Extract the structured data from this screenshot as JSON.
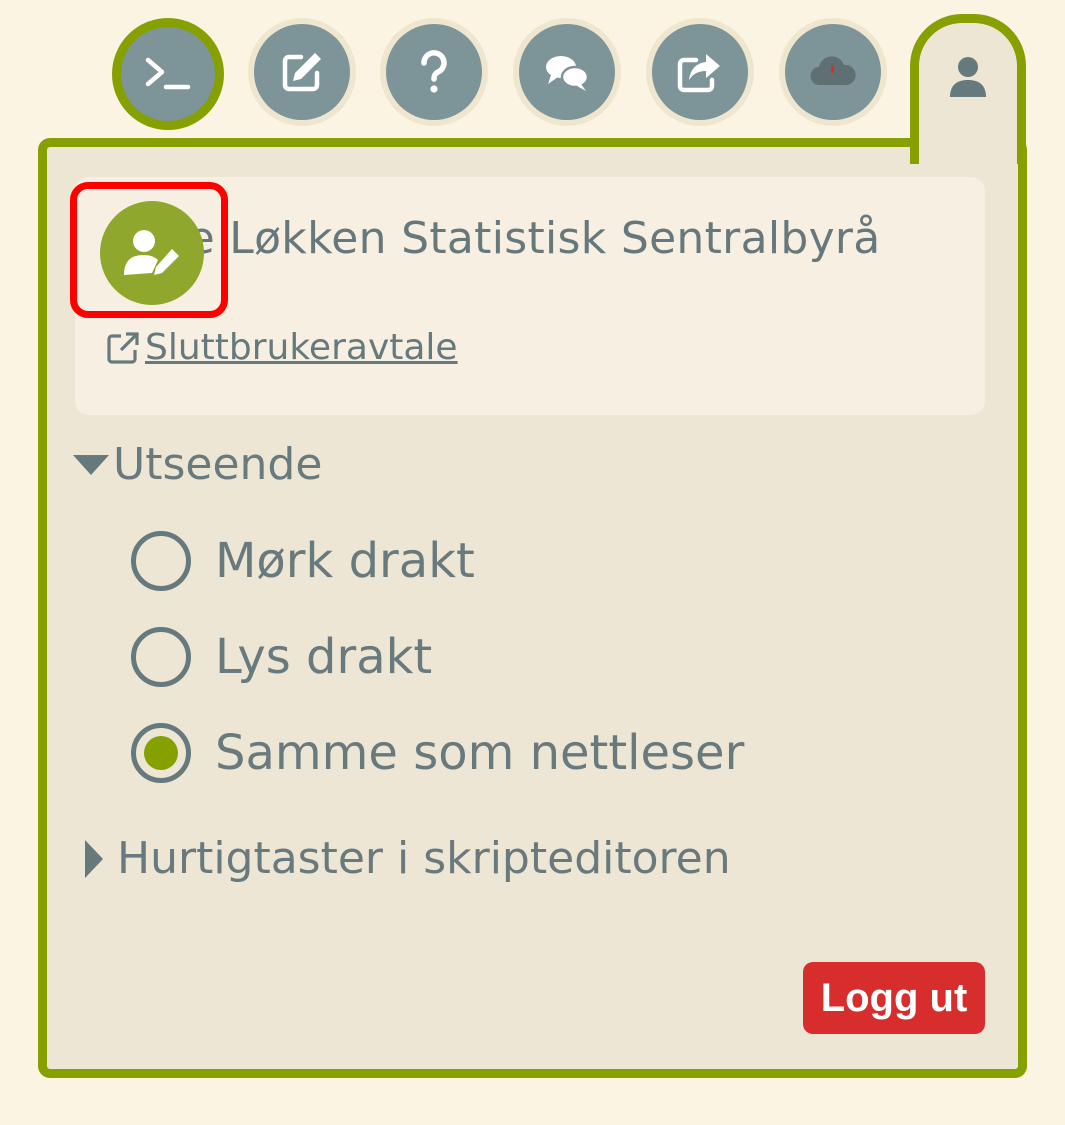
{
  "toolbar": {
    "buttons": [
      {
        "name": "terminal",
        "icon": "terminal-icon",
        "active": true
      },
      {
        "name": "edit",
        "icon": "edit-icon"
      },
      {
        "name": "help",
        "icon": "question-icon"
      },
      {
        "name": "chat",
        "icon": "chat-bubbles-icon"
      },
      {
        "name": "share",
        "icon": "share-icon"
      },
      {
        "name": "cloud",
        "icon": "cloud-icon"
      }
    ],
    "user_tab_icon": "user-icon",
    "active_color": "#86a000"
  },
  "user_panel": {
    "user_name": "Lene Løkken Statistisk Sentralbyrå",
    "avatar_icon": "user-edit-icon",
    "agreement_link": "Sluttbrukeravtale",
    "agreement_icon": "external-link-icon",
    "appearance": {
      "title": "Utseende",
      "expanded": true,
      "options": [
        {
          "label": "Mørk drakt",
          "checked": false
        },
        {
          "label": "Lys drakt",
          "checked": false
        },
        {
          "label": "Samme som nettleser",
          "checked": true
        }
      ]
    },
    "shortcuts": {
      "title": "Hurtigtaster i skripteditoren",
      "expanded": false
    },
    "logout_label": "Logg ut"
  },
  "colors": {
    "page_background": "#fbf4e2",
    "panel_background": "#eee6d4",
    "accent_green": "#86a000",
    "icon_gray": "#7d9498",
    "text_gray": "#687a7e",
    "logout_red": "#d72d2d",
    "highlight_red": "#ff0000"
  }
}
